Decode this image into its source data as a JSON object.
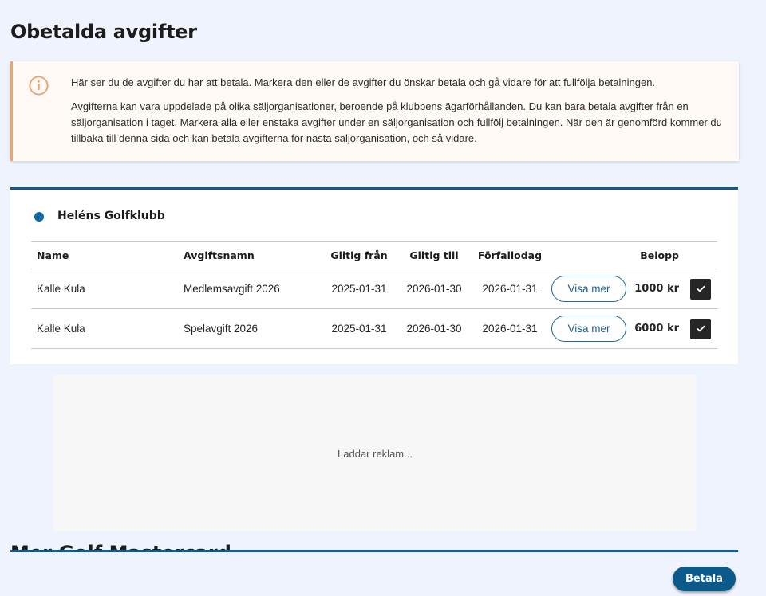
{
  "page": {
    "title": "Obetalda avgifter"
  },
  "info": {
    "icon": "info-icon",
    "paragraph1": "Här ser du de avgifter du har att betala. Markera den eller de avgifter du önskar betala och gå vidare för att fullfölja betalningen.",
    "paragraph2": "Avgifterna kan vara uppdelade på olika säljorganisationer, beroende på klubbens ägarförhållanden. Du kan bara betala avgifter från en säljorganisation i taget. Markera alla eller enstaka avgifter under en säljorganisation och fullfölj betalningen. När den är genomförd kommer du tillbaka till denna sida och kan betala avgifterna för nästa säljorganisation, och så vidare.",
    "accent_color": "#e8a572"
  },
  "club": {
    "name": "Heléns Golfklubb",
    "accent_color": "#0d5c8b",
    "columns": {
      "name": "Name",
      "fee_name": "Avgiftsnamn",
      "valid_from": "Giltig från",
      "valid_to": "Giltig till",
      "due_date": "Förfallodag",
      "amount": "Belopp"
    },
    "rows": [
      {
        "name": "Kalle Kula",
        "fee_name": "Medlemsavgift 2026",
        "valid_from": "2025-01-31",
        "valid_to": "2026-01-30",
        "due_date": "2026-01-31",
        "button": "Visa mer",
        "amount": "1000 kr",
        "checked": true
      },
      {
        "name": "Kalle Kula",
        "fee_name": "Spelavgift 2026",
        "valid_from": "2025-01-31",
        "valid_to": "2026-01-30",
        "due_date": "2026-01-31",
        "button": "Visa mer",
        "amount": "6000 kr",
        "checked": true
      }
    ]
  },
  "ad": {
    "loading_text": "Laddar reklam..."
  },
  "next_club": {
    "name_partial": "Mer Golf Mastercard"
  },
  "footer": {
    "pay_button": "Betala",
    "pay_color": "#0b5a8a"
  }
}
